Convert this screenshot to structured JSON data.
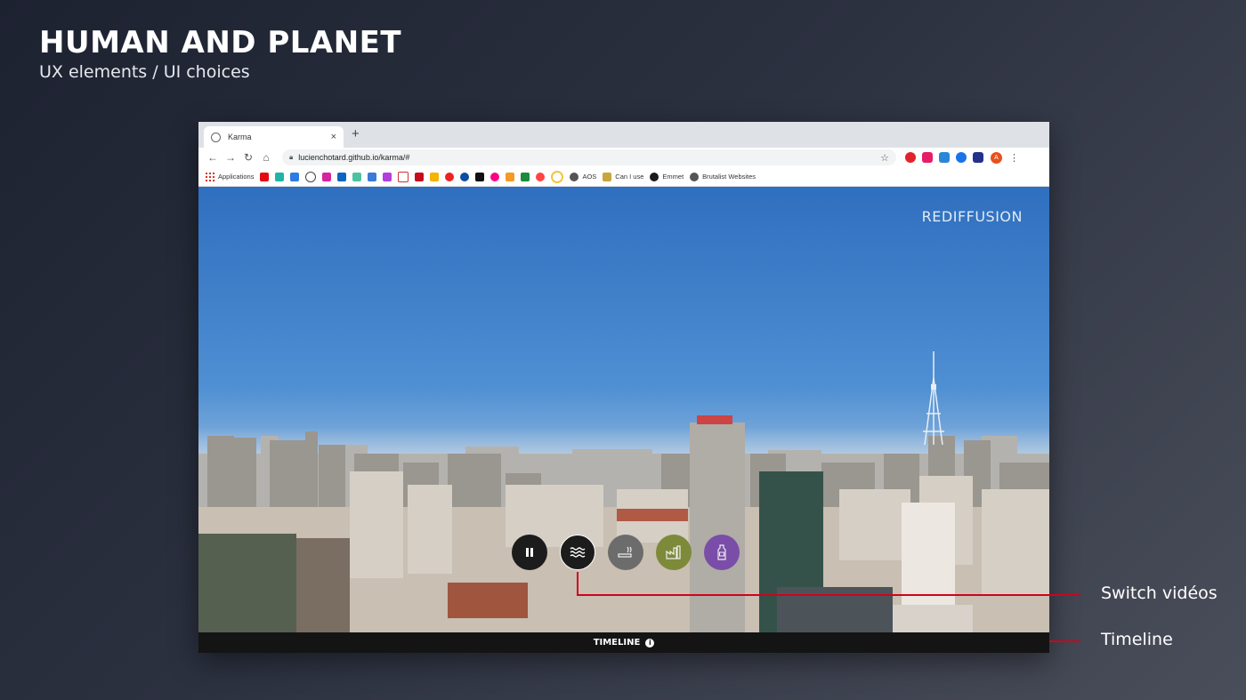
{
  "slide": {
    "title": "HUMAN AND PLANET",
    "subtitle": "UX elements / UI choices"
  },
  "browser": {
    "tab_title": "Karma",
    "new_tab_symbol": "+",
    "close_symbol": "×",
    "url": "lucienchotard.github.io/karma/#",
    "profile_initial": "A",
    "bookmarks": {
      "applications": "Applications",
      "aos": "AOS",
      "caniuse": "Can I use",
      "emmet": "Emmet",
      "brutalist": "Brutalist Websites"
    }
  },
  "video": {
    "watermark": "REDIFFUSION",
    "controls": [
      {
        "name": "pause-icon",
        "color": "#1c1c1c"
      },
      {
        "name": "waves-icon",
        "color": "#1c1c1c"
      },
      {
        "name": "smoking-icon",
        "color": "#6c6c6c"
      },
      {
        "name": "factory-icon",
        "color": "#7d8a3a"
      },
      {
        "name": "bottle-icon",
        "color": "#7a4ea8"
      }
    ]
  },
  "timeline": {
    "label": "TIMELINE",
    "info": "i"
  },
  "callouts": {
    "switch_videos": "Switch vidéos",
    "timeline": "Timeline",
    "line_color": "#d0021b"
  }
}
